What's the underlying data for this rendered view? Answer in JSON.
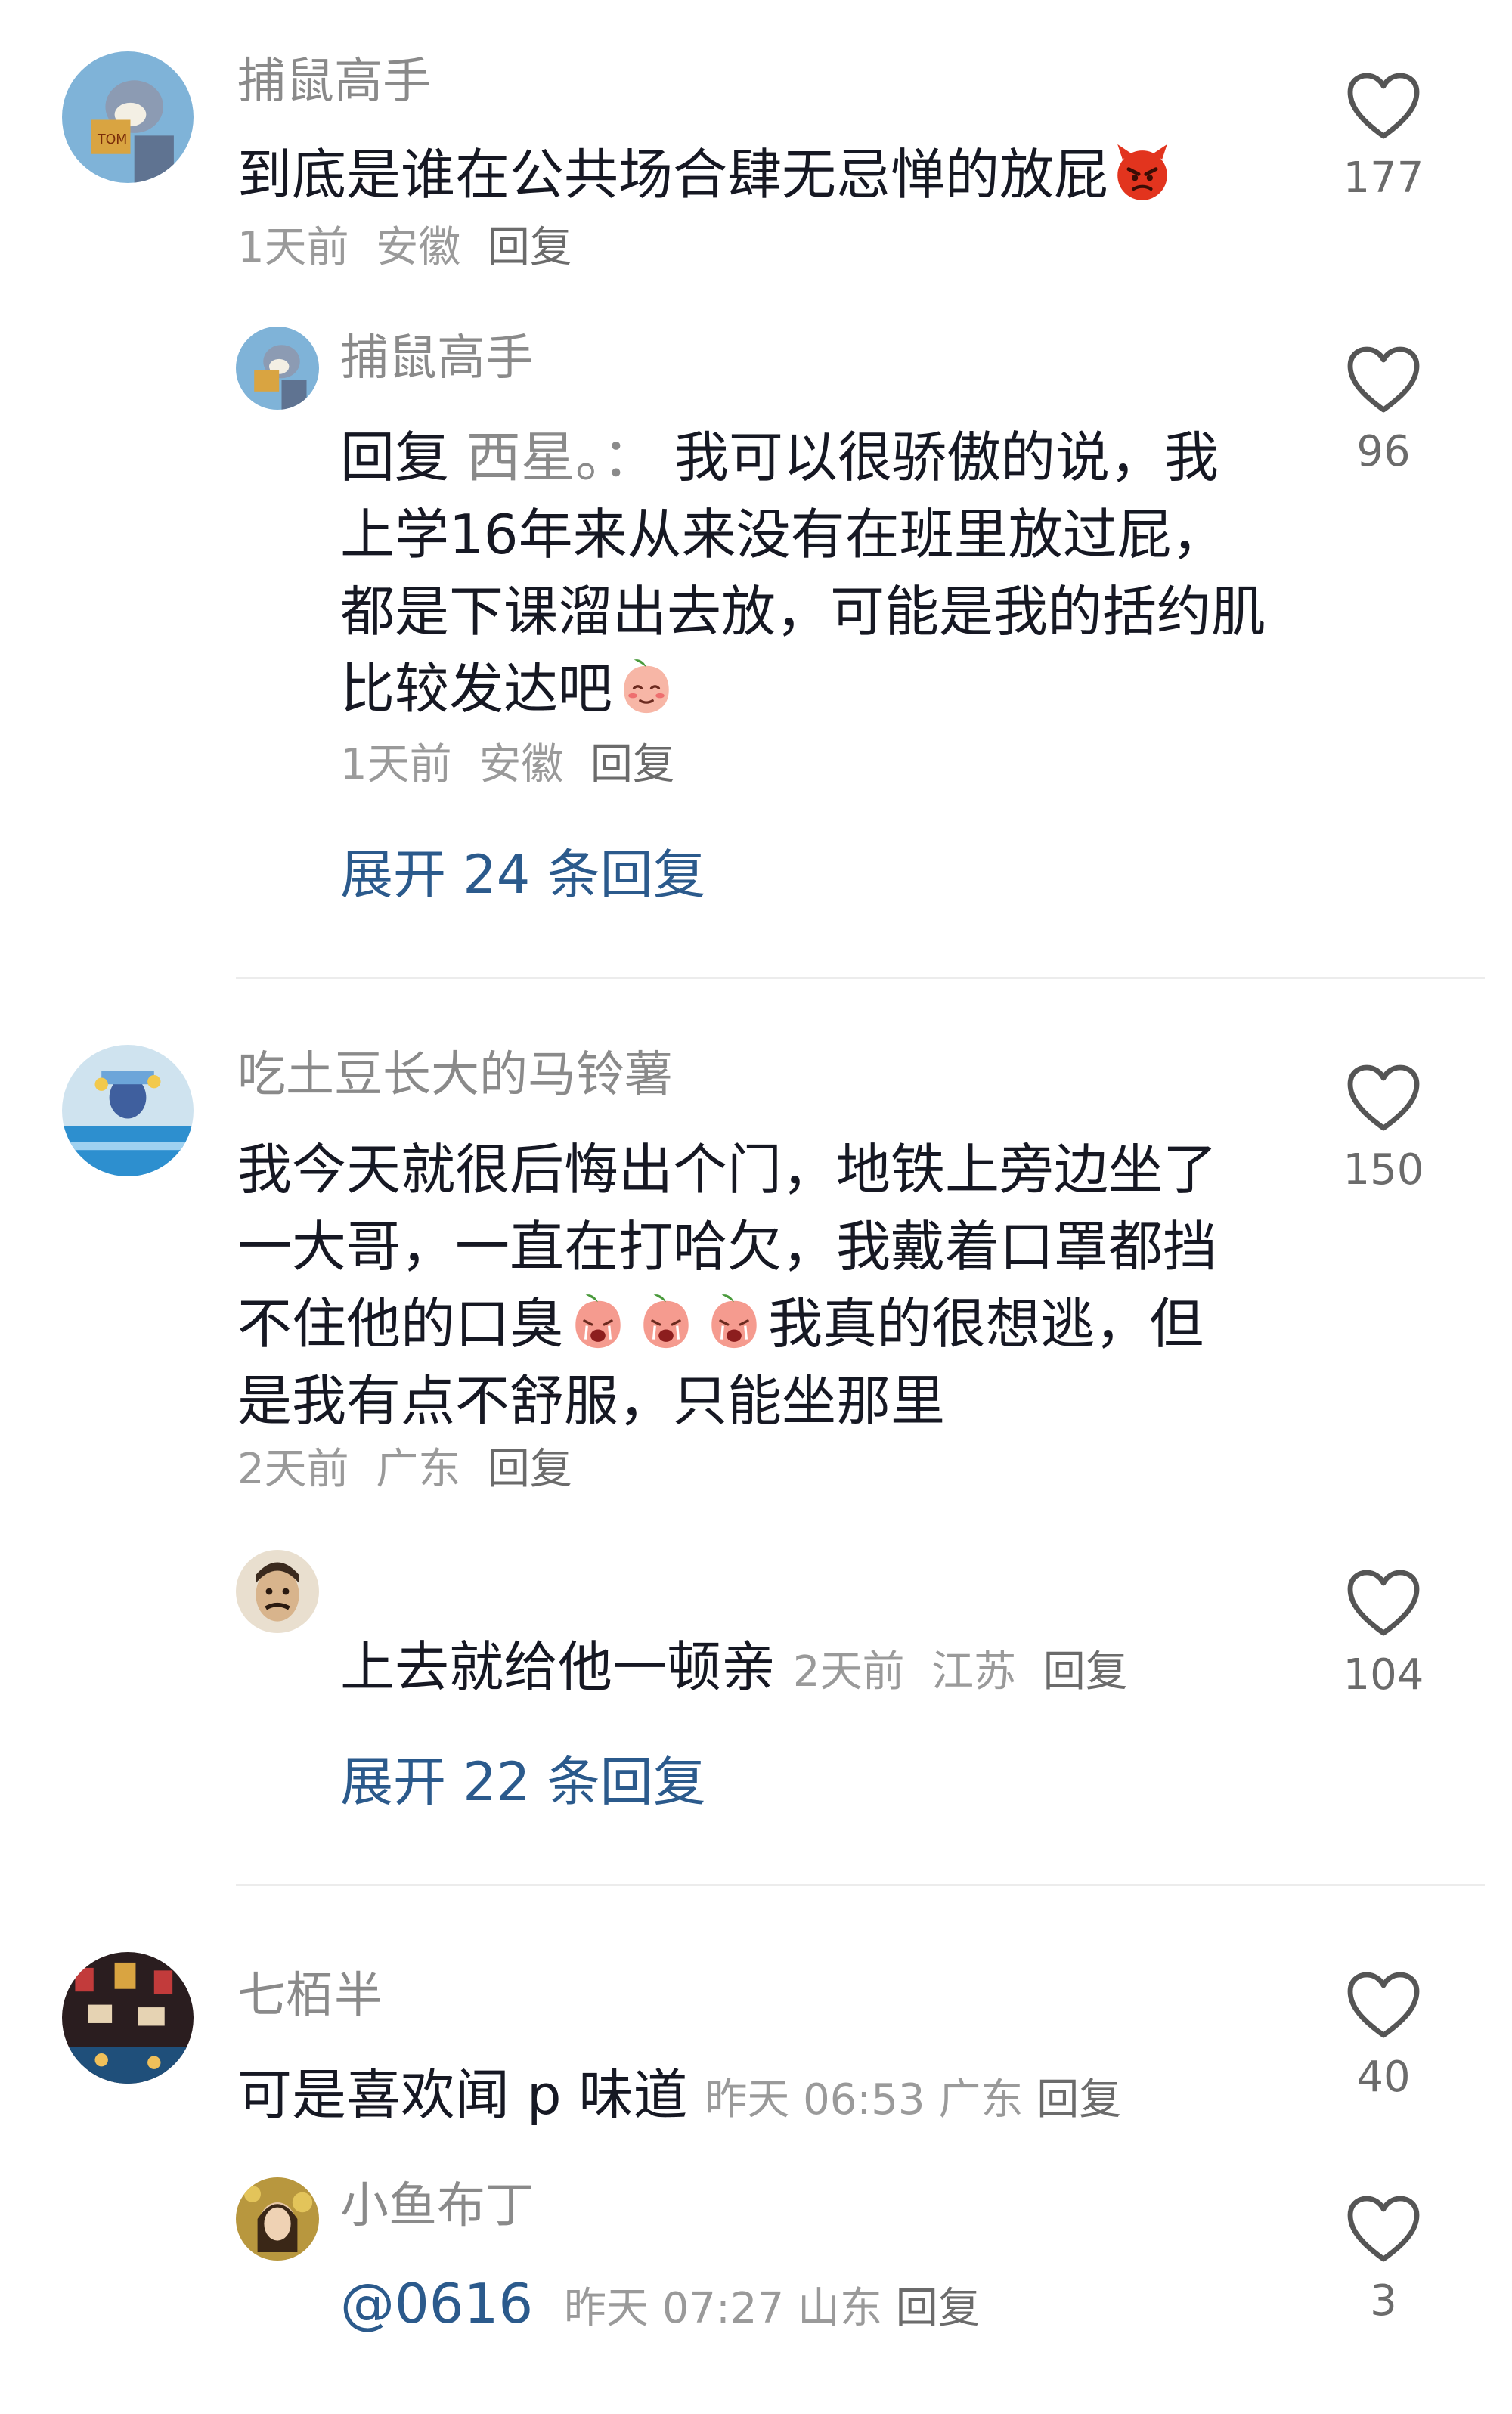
{
  "comments": [
    {
      "author": "捕鼠高手",
      "text": "到底是谁在公共场合肆无忌惮的放屁",
      "emoji": "angry-devil-emoji",
      "time": "1天前",
      "location": "安徽",
      "reply_label": "回复",
      "likes": "177",
      "reply": {
        "author": "捕鼠高手",
        "reply_prefix": "回复",
        "reply_to": "西星。：",
        "text": "我可以很骄傲的说，我上学16年来从来没有在班里放过屁，都是下课溜出去放，可能是我的括约肌比较发达吧",
        "emoji": "shy-peach-emoji",
        "time": "1天前",
        "location": "安徽",
        "reply_label": "回复",
        "likes": "96"
      },
      "expand_label": "展开 24 条回复"
    },
    {
      "author": "吃土豆长大的马铃薯",
      "text_part1": "我今天就很后悔出个门，地铁上旁边坐了一大哥，一直在打哈欠，我戴着口罩都挡不住他的口臭",
      "emoji": "crying-peach-emoji",
      "text_part2": "我真的很想逃，但是我有点不舒服，只能坐那里",
      "time": "2天前",
      "location": "广东",
      "reply_label": "回复",
      "likes": "150",
      "reply": {
        "author": "",
        "text": "上去就给他一顿亲",
        "time": "2天前",
        "location": "江苏",
        "reply_label": "回复",
        "likes": "104"
      },
      "expand_label": "展开 22 条回复"
    },
    {
      "author": "七栢半",
      "text": "可是喜欢闻 p 味道",
      "time": "昨天 06:53",
      "location": "广东",
      "reply_label": "回复",
      "likes": "40",
      "reply": {
        "author": "小鱼布丁",
        "mention": "@0616",
        "time": "昨天 07:27",
        "location": "山东",
        "reply_label": "回复",
        "likes": "3"
      }
    }
  ],
  "colors": {
    "link_blue": "#2b5a8c",
    "name_gray": "#8a8a8a",
    "text_dark": "#161823",
    "divider": "#ececec"
  }
}
